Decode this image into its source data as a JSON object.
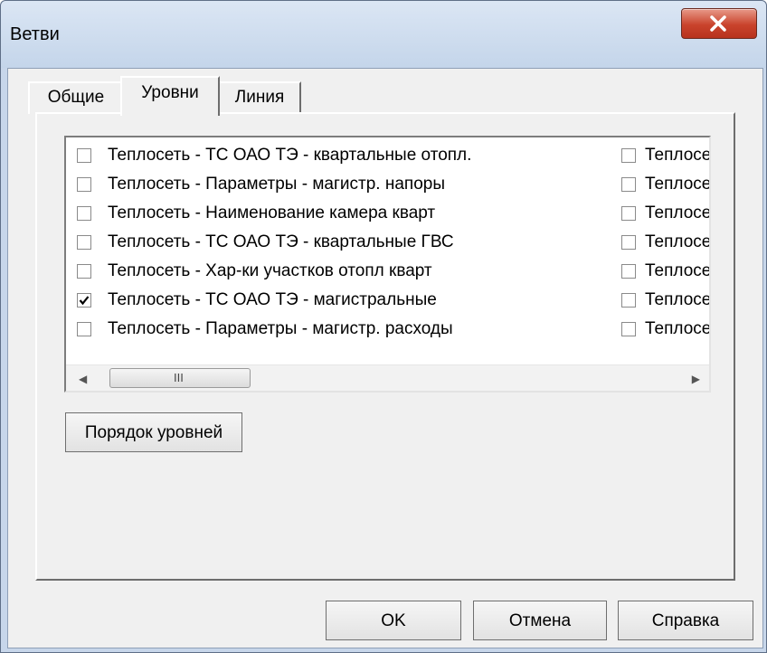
{
  "window": {
    "title": "Ветви"
  },
  "tabs": [
    {
      "label": "Общие",
      "active": false
    },
    {
      "label": "Уровни",
      "active": true
    },
    {
      "label": "Линия",
      "active": false
    }
  ],
  "levels_list": {
    "column1": [
      {
        "label": "Теплосеть - ТС ОАО ТЭ - квартальные отопл.",
        "checked": false
      },
      {
        "label": "Теплосеть - Параметры - магистр. напоры",
        "checked": false
      },
      {
        "label": "Теплосеть - Наименование камера кварт",
        "checked": false
      },
      {
        "label": "Теплосеть - ТС ОАО ТЭ - квартальные ГВС",
        "checked": false
      },
      {
        "label": "Теплосеть - Хар-ки участков отопл кварт",
        "checked": false
      },
      {
        "label": "Теплосеть - ТС ОАО ТЭ - магистральные",
        "checked": true
      },
      {
        "label": "Теплосеть - Параметры - магистр. расходы",
        "checked": false
      }
    ],
    "column2": [
      {
        "label": "Теплосе",
        "checked": false
      },
      {
        "label": "Теплосе",
        "checked": false
      },
      {
        "label": "Теплосе",
        "checked": false
      },
      {
        "label": "Теплосе",
        "checked": false
      },
      {
        "label": "Теплосе",
        "checked": false
      },
      {
        "label": "Теплосе",
        "checked": false
      },
      {
        "label": "Теплосе",
        "checked": false
      }
    ],
    "scroll_grip": "III"
  },
  "buttons": {
    "order_levels": "Порядок уровней",
    "ok": "OK",
    "cancel": "Отмена",
    "help": "Справка"
  }
}
